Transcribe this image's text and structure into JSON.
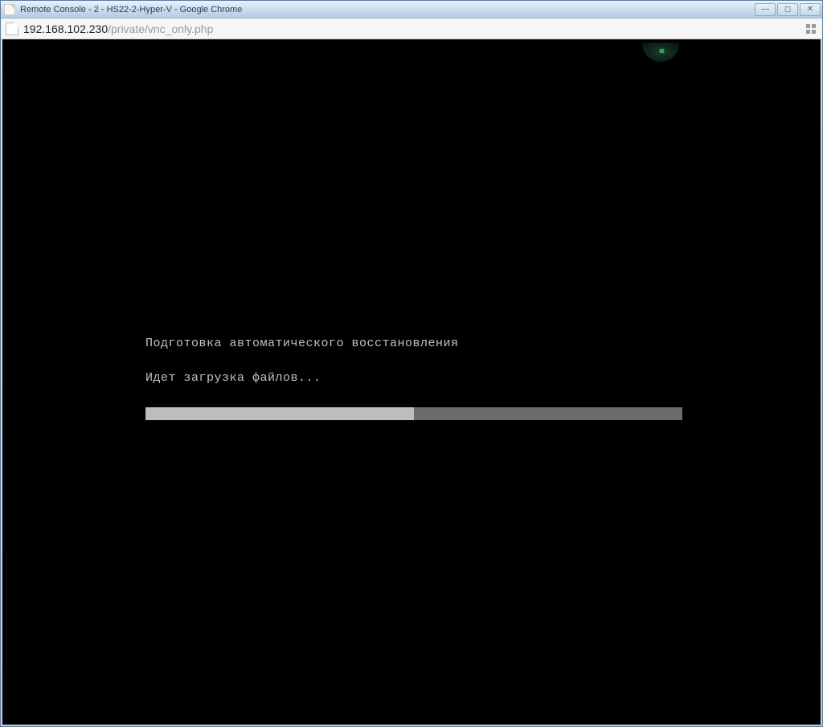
{
  "window": {
    "title": "Remote Console - 2 - HS22-2-Hyper-V - Google Chrome",
    "minimize_glyph": "—",
    "maximize_glyph": "◻",
    "close_glyph": "✕"
  },
  "addressbar": {
    "host": "192.168.102.230",
    "path": "/private/vnc_only.php"
  },
  "vnc": {
    "panel_glyph": "«",
    "boot_line1": "Подготовка автоматического восстановления",
    "boot_line2": "Идет загрузка файлов...",
    "progress_percent": 50
  }
}
